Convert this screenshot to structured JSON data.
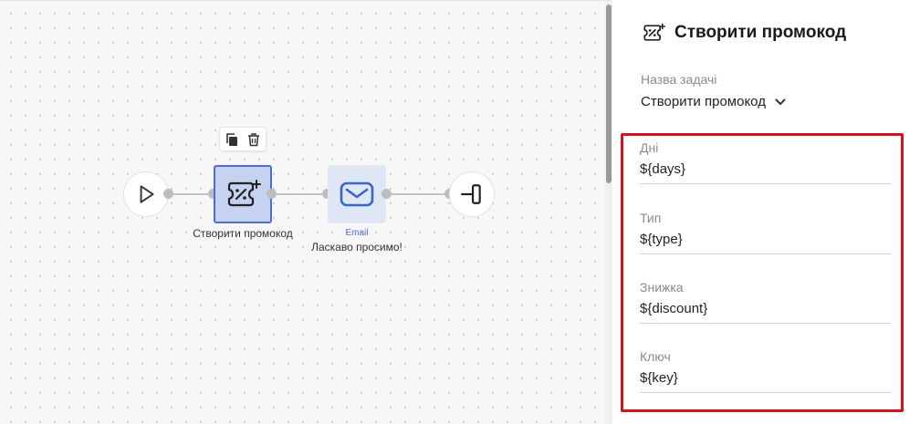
{
  "canvas": {
    "nodes": {
      "start": {
        "icon": "play-icon"
      },
      "promo": {
        "icon": "promo-code-icon",
        "label": "Створити промокод"
      },
      "email": {
        "icon": "envelope-icon",
        "type_label": "Email",
        "label": "Ласкаво просимо!"
      },
      "end": {
        "icon": "exit-icon"
      }
    },
    "toolbar": {
      "copy_icon": "copy-icon",
      "delete_icon": "trash-icon"
    }
  },
  "panel": {
    "title": "Створити промокод",
    "title_icon": "promo-code-icon",
    "task_name_label": "Назва задачі",
    "task_name_value": "Створити промокод",
    "fields": [
      {
        "label": "Дні",
        "value": "${days}"
      },
      {
        "label": "Тип",
        "value": "${type}"
      },
      {
        "label": "Знижка",
        "value": "${discount}"
      },
      {
        "label": "Ключ",
        "value": "${key}"
      }
    ]
  },
  "colors": {
    "accent": "#4a6fd0",
    "selected_node_bg": "#c5d2f0",
    "highlight_border": "#d0141a"
  }
}
